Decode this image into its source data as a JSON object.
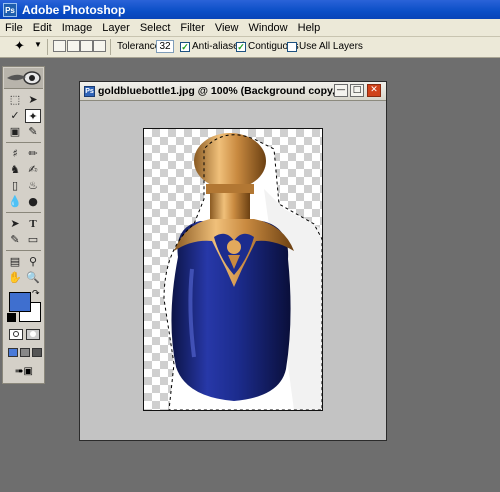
{
  "app": {
    "title": "Adobe Photoshop",
    "icon": "photoshop-app-icon"
  },
  "menu": {
    "items": [
      "File",
      "Edit",
      "Image",
      "Layer",
      "Select",
      "Filter",
      "View",
      "Window",
      "Help"
    ]
  },
  "options": {
    "tool_icon": "magic-wand-icon",
    "tolerance_label": "Tolerance:",
    "tolerance_value": "32",
    "anti_aliased_label": "Anti-aliased",
    "anti_aliased_checked": true,
    "contiguous_label": "Contiguous",
    "contiguous_checked": true,
    "use_all_layers_label": "Use All Layers",
    "use_all_layers_checked": false
  },
  "toolbox": {
    "tools": [
      "marquee",
      "move",
      "lasso",
      "magic-wand",
      "crop",
      "slice",
      "healing-brush",
      "brush",
      "clone-stamp",
      "history-brush",
      "eraser",
      "paint-bucket",
      "blur",
      "dodge",
      "path-selection",
      "type",
      "pen",
      "shape",
      "notes",
      "eyedropper",
      "hand",
      "zoom"
    ],
    "selected_tool": "magic-wand",
    "colors": {
      "foreground": "#3f6fcf",
      "background": "#ffffff"
    }
  },
  "document": {
    "title": "goldbluebottle1.jpg @ 100% (Background copy, ...",
    "colors": {
      "bottle": "#1c2c8e",
      "gold": "#d29a52"
    }
  }
}
